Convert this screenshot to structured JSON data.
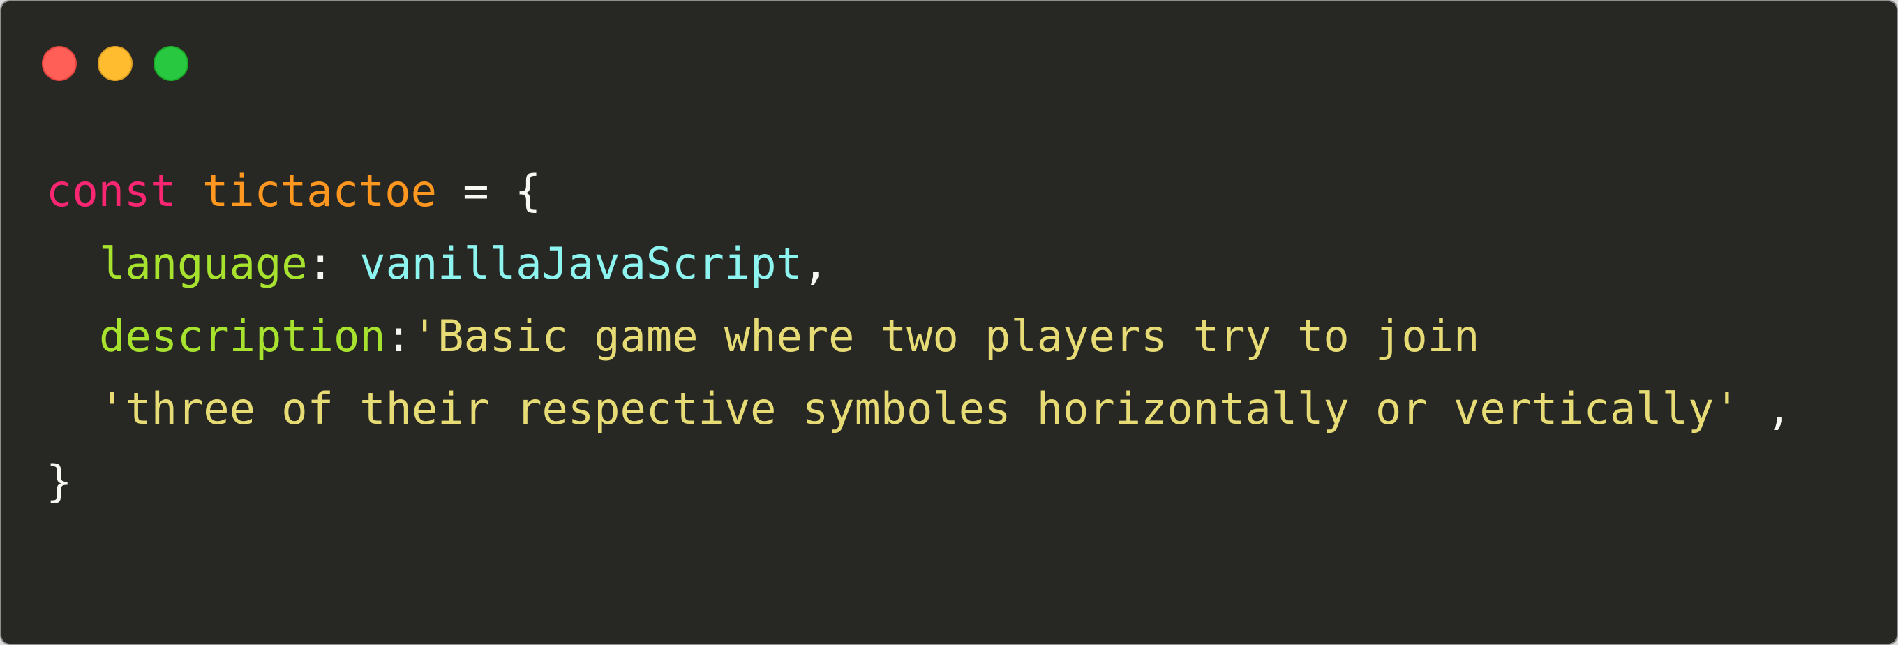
{
  "window": {
    "buttons": {
      "close": "close-button",
      "minimize": "minimize-button",
      "maximize": "maximize-button"
    },
    "colors": {
      "background": "#272823",
      "close": "#ff5f57",
      "minimize": "#febc2e",
      "maximize": "#28c840"
    }
  },
  "code": {
    "line1": {
      "keyword": "const",
      "name": "tictactoe",
      "operator": " = ",
      "brace": "{"
    },
    "line2": {
      "key": "language",
      "colon": ": ",
      "value": "vanillaJavaScript",
      "comma": ","
    },
    "line3": {
      "key": "description",
      "colon": ":",
      "value": "'Basic game where two players try to join"
    },
    "line4": {
      "value": "'three of their respective symboles horizontally or vertically'",
      "comma": " ,"
    },
    "line5": {
      "brace": "}"
    },
    "colors": {
      "keyword": "#f92672",
      "name": "#fd971f",
      "property": "#a6e22e",
      "identifier": "#8ef4f0",
      "string": "#e6db74",
      "punctuation": "#f8f8f2"
    }
  }
}
